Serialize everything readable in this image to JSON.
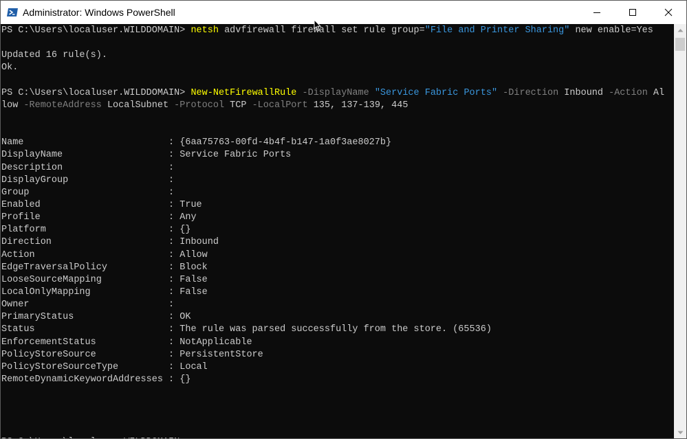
{
  "window": {
    "title": "Administrator: Windows PowerShell",
    "icons": {
      "app": "powershell-icon",
      "minimize": "minimize-icon",
      "maximize": "maximize-icon",
      "close": "close-icon",
      "cursor": "mouse-pointer-icon"
    }
  },
  "colors": {
    "console_bg": "#0c0c0c",
    "text": "#cccccc",
    "command": "#ffff00",
    "parameter": "#808080",
    "string": "#3a96dd",
    "titlebar_bg": "#ffffff",
    "scrollbar_bg": "#f0f0f0",
    "scrollbar_thumb": "#cdcdcd"
  },
  "console": {
    "lines": [
      [
        {
          "t": "plain",
          "v": "PS C:\\Users\\localuser.WILDDOMAIN> "
        },
        {
          "t": "cmd",
          "v": "netsh"
        },
        {
          "t": "plain",
          "v": " advfirewall firewall set rule group="
        },
        {
          "t": "str",
          "v": "\"File and Printer Sharing\""
        },
        {
          "t": "plain",
          "v": " new enable=Yes"
        }
      ],
      [],
      [
        {
          "t": "plain",
          "v": "Updated 16 rule(s)."
        }
      ],
      [
        {
          "t": "plain",
          "v": "Ok."
        }
      ],
      [],
      [
        {
          "t": "plain",
          "v": "PS C:\\Users\\localuser.WILDDOMAIN> "
        },
        {
          "t": "cmd",
          "v": "New-NetFirewallRule"
        },
        {
          "t": "param",
          "v": " -DisplayName"
        },
        {
          "t": "str",
          "v": " \"Service Fabric Ports\""
        },
        {
          "t": "param",
          "v": " -Direction"
        },
        {
          "t": "plain",
          "v": " Inbound"
        },
        {
          "t": "param",
          "v": " -Action"
        },
        {
          "t": "plain",
          "v": " Al"
        }
      ],
      [
        {
          "t": "plain",
          "v": "low"
        },
        {
          "t": "param",
          "v": " -RemoteAddress"
        },
        {
          "t": "plain",
          "v": " LocalSubnet"
        },
        {
          "t": "param",
          "v": " -Protocol"
        },
        {
          "t": "plain",
          "v": " TCP"
        },
        {
          "t": "param",
          "v": " -LocalPort"
        },
        {
          "t": "plain",
          "v": " 135, 137-139, 445"
        }
      ],
      [],
      [],
      [
        {
          "t": "plain",
          "v": "Name                          : {6aa75763-00fd-4b4f-b147-1a0f3ae8027b}"
        }
      ],
      [
        {
          "t": "plain",
          "v": "DisplayName                   : Service Fabric Ports"
        }
      ],
      [
        {
          "t": "plain",
          "v": "Description                   :"
        }
      ],
      [
        {
          "t": "plain",
          "v": "DisplayGroup                  :"
        }
      ],
      [
        {
          "t": "plain",
          "v": "Group                         :"
        }
      ],
      [
        {
          "t": "plain",
          "v": "Enabled                       : True"
        }
      ],
      [
        {
          "t": "plain",
          "v": "Profile                       : Any"
        }
      ],
      [
        {
          "t": "plain",
          "v": "Platform                      : {}"
        }
      ],
      [
        {
          "t": "plain",
          "v": "Direction                     : Inbound"
        }
      ],
      [
        {
          "t": "plain",
          "v": "Action                        : Allow"
        }
      ],
      [
        {
          "t": "plain",
          "v": "EdgeTraversalPolicy           : Block"
        }
      ],
      [
        {
          "t": "plain",
          "v": "LooseSourceMapping            : False"
        }
      ],
      [
        {
          "t": "plain",
          "v": "LocalOnlyMapping              : False"
        }
      ],
      [
        {
          "t": "plain",
          "v": "Owner                         :"
        }
      ],
      [
        {
          "t": "plain",
          "v": "PrimaryStatus                 : OK"
        }
      ],
      [
        {
          "t": "plain",
          "v": "Status                        : The rule was parsed successfully from the store. (65536)"
        }
      ],
      [
        {
          "t": "plain",
          "v": "EnforcementStatus             : NotApplicable"
        }
      ],
      [
        {
          "t": "plain",
          "v": "PolicyStoreSource             : PersistentStore"
        }
      ],
      [
        {
          "t": "plain",
          "v": "PolicyStoreSourceType         : Local"
        }
      ],
      [
        {
          "t": "plain",
          "v": "RemoteDynamicKeywordAddresses : {}"
        }
      ],
      [],
      [],
      [],
      [],
      [
        {
          "t": "plain",
          "v": "PS C:\\Users\\localuser.WILDDOMAIN>"
        }
      ]
    ]
  }
}
